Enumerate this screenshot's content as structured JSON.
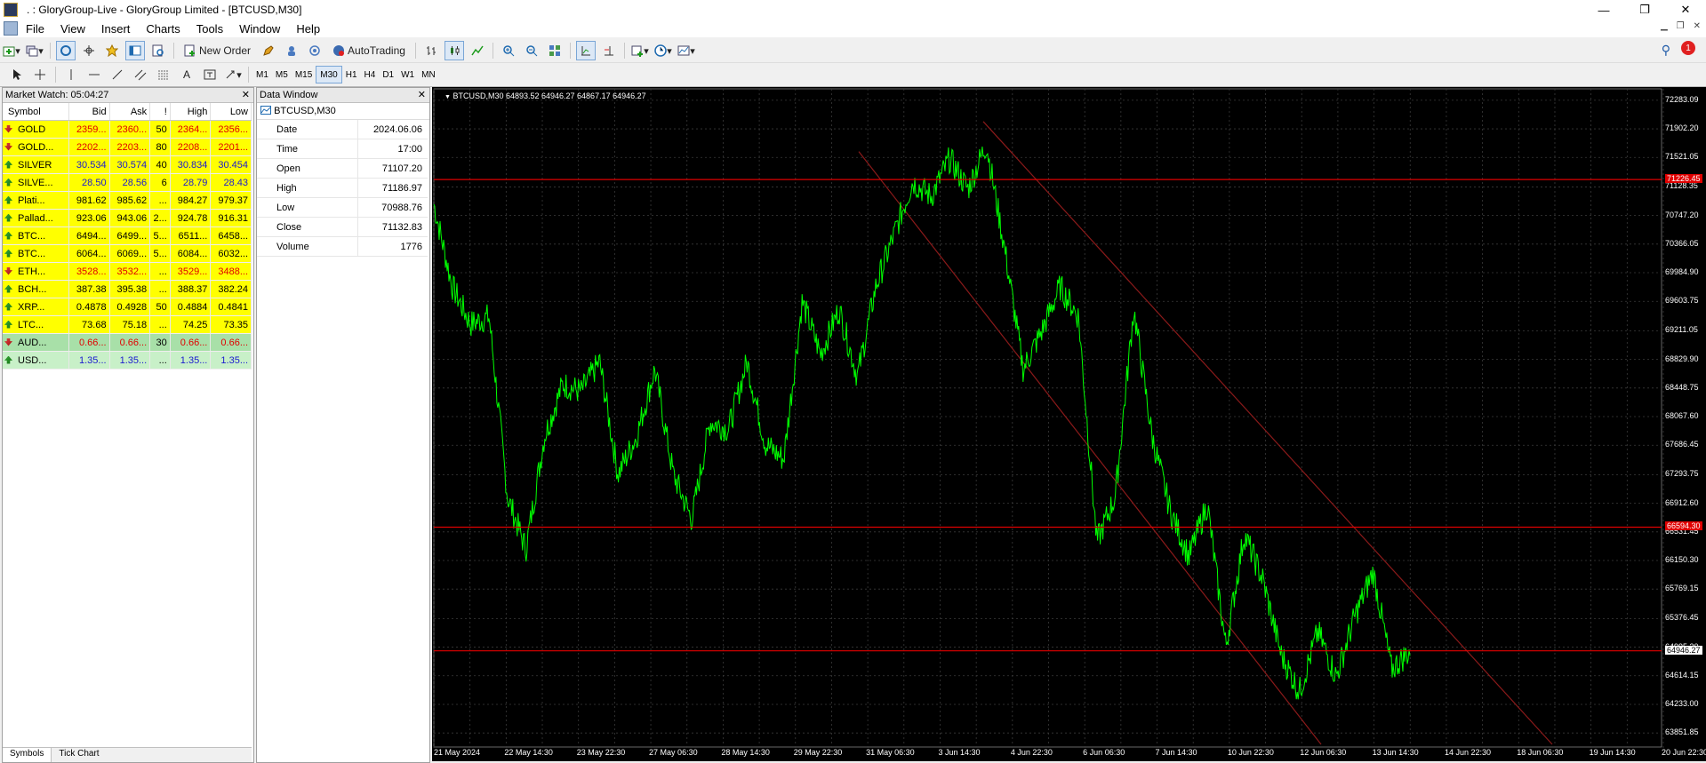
{
  "window": {
    "title": "   .   : GloryGroup-Live - GloryGroup Limited - [BTCUSD,M30]",
    "controls": [
      "—",
      "❐",
      "✕"
    ]
  },
  "menu": [
    "File",
    "View",
    "Insert",
    "Charts",
    "Tools",
    "Window",
    "Help"
  ],
  "toolbar": {
    "new_order": "New Order",
    "autotrading": "AutoTrading",
    "notification_count": "1"
  },
  "timeframes": [
    "M1",
    "M5",
    "M15",
    "M30",
    "H1",
    "H4",
    "D1",
    "W1",
    "MN"
  ],
  "active_timeframe": "M30",
  "market_watch": {
    "title": "Market Watch: 05:04:27",
    "columns": [
      "Symbol",
      "Bid",
      "Ask",
      "!",
      "High",
      "Low"
    ],
    "rows": [
      {
        "symbol": "GOLD",
        "bid": "2359...",
        "ask": "2360...",
        "spread": "50",
        "high": "2364...",
        "low": "2356...",
        "dir": "down",
        "bg": "#ffff00",
        "color": "#e00000"
      },
      {
        "symbol": "GOLD...",
        "bid": "2202...",
        "ask": "2203...",
        "spread": "80",
        "high": "2208...",
        "low": "2201...",
        "dir": "down",
        "bg": "#ffff00",
        "color": "#e00000"
      },
      {
        "symbol": "SILVER",
        "bid": "30.534",
        "ask": "30.574",
        "spread": "40",
        "high": "30.834",
        "low": "30.454",
        "dir": "up",
        "bg": "#ffff00",
        "color": "#1a1ad0"
      },
      {
        "symbol": "SILVE...",
        "bid": "28.50",
        "ask": "28.56",
        "spread": "6",
        "high": "28.79",
        "low": "28.43",
        "dir": "up",
        "bg": "#ffff00",
        "color": "#1a1ad0"
      },
      {
        "symbol": "Plati...",
        "bid": "981.62",
        "ask": "985.62",
        "spread": "...",
        "high": "984.27",
        "low": "979.37",
        "dir": "up",
        "bg": "#ffff00",
        "color": "#000000"
      },
      {
        "symbol": "Pallad...",
        "bid": "923.06",
        "ask": "943.06",
        "spread": "2...",
        "high": "924.78",
        "low": "916.31",
        "dir": "up",
        "bg": "#ffff00",
        "color": "#000000"
      },
      {
        "symbol": "BTC...",
        "bid": "6494...",
        "ask": "6499...",
        "spread": "5...",
        "high": "6511...",
        "low": "6458...",
        "dir": "up",
        "bg": "#ffff00",
        "color": "#000000"
      },
      {
        "symbol": "BTC...",
        "bid": "6064...",
        "ask": "6069...",
        "spread": "5...",
        "high": "6084...",
        "low": "6032...",
        "dir": "up",
        "bg": "#ffff00",
        "color": "#000000"
      },
      {
        "symbol": "ETH...",
        "bid": "3528...",
        "ask": "3532...",
        "spread": "...",
        "high": "3529...",
        "low": "3488...",
        "dir": "down",
        "bg": "#ffff00",
        "color": "#e00000"
      },
      {
        "symbol": "BCH...",
        "bid": "387.38",
        "ask": "395.38",
        "spread": "...",
        "high": "388.37",
        "low": "382.24",
        "dir": "up",
        "bg": "#ffff00",
        "color": "#000000"
      },
      {
        "symbol": "XRP...",
        "bid": "0.4878",
        "ask": "0.4928",
        "spread": "50",
        "high": "0.4884",
        "low": "0.4841",
        "dir": "up",
        "bg": "#ffff00",
        "color": "#000000"
      },
      {
        "symbol": "LTC...",
        "bid": "73.68",
        "ask": "75.18",
        "spread": "...",
        "high": "74.25",
        "low": "73.35",
        "dir": "up",
        "bg": "#ffff00",
        "color": "#000000"
      },
      {
        "symbol": "AUD...",
        "bid": "0.66...",
        "ask": "0.66...",
        "spread": "30",
        "high": "0.66...",
        "low": "0.66...",
        "dir": "down",
        "bg": "#a8e0a8",
        "color": "#e00000"
      },
      {
        "symbol": "USD...",
        "bid": "1.35...",
        "ask": "1.35...",
        "spread": "...",
        "high": "1.35...",
        "low": "1.35...",
        "dir": "up",
        "bg": "#c8f0c8",
        "color": "#1a1ad0"
      }
    ],
    "tabs": [
      "Symbols",
      "Tick Chart"
    ]
  },
  "data_window": {
    "title": "Data Window",
    "symbol": "BTCUSD,M30",
    "rows": [
      {
        "k": "Date",
        "v": "2024.06.06"
      },
      {
        "k": "Time",
        "v": "17:00"
      },
      {
        "k": "Open",
        "v": "71107.20"
      },
      {
        "k": "High",
        "v": "71186.97"
      },
      {
        "k": "Low",
        "v": "70988.76"
      },
      {
        "k": "Close",
        "v": "71132.83"
      },
      {
        "k": "Volume",
        "v": "1776"
      }
    ]
  },
  "chart": {
    "info": "BTCUSD,M30  64893.52 64946.27 64867.17 64946.27",
    "colors": {
      "background": "#000000",
      "line": "#00ff00",
      "grid": "#3a3a3a",
      "level": "#e00000",
      "channel": "#8b1a1a"
    },
    "price_labels": [
      "72283.09",
      "71902.20",
      "71521.05",
      "71128.35",
      "70747.20",
      "70366.05",
      "69984.90",
      "69603.75",
      "69211.05",
      "68829.90",
      "68448.75",
      "68067.60",
      "67686.45",
      "67293.75",
      "66912.60",
      "66531.45",
      "66150.30",
      "65769.15",
      "65376.45",
      "64995.30",
      "64614.15",
      "64233.00",
      "63851.85"
    ],
    "levels": [
      {
        "price": "71226.45",
        "style": "red"
      },
      {
        "price": "66594.30",
        "style": "red"
      },
      {
        "price": "64946.27",
        "style": "white"
      }
    ],
    "time_labels": [
      "21 May 2024",
      "22 May 14:30",
      "23 May 22:30",
      "27 May 06:30",
      "28 May 14:30",
      "29 May 22:30",
      "31 May 06:30",
      "3 Jun 14:30",
      "4 Jun 22:30",
      "6 Jun 06:30",
      "7 Jun 14:30",
      "10 Jun 22:30",
      "12 Jun 06:30",
      "13 Jun 14:30",
      "14 Jun 22:30",
      "18 Jun 06:30",
      "19 Jun 14:30",
      "20 Jun 22:30"
    ]
  },
  "chart_data": {
    "type": "line",
    "ylim": [
      63700,
      72400
    ],
    "x": [
      "21 May 2024",
      "22 May 14:30",
      "23 May 22:30",
      "27 May 06:30",
      "28 May 14:30",
      "29 May 22:30",
      "31 May 06:30",
      "3 Jun 14:30",
      "4 Jun 22:30",
      "6 Jun 06:30",
      "7 Jun 14:30",
      "10 Jun 22:30",
      "12 Jun 06:30",
      "13 Jun 14:30",
      "14 Jun 22:30",
      "18 Jun 06:30",
      "19 Jun 14:30",
      "20 Jun 22:30"
    ],
    "series": [
      {
        "values": [
          70900,
          69800,
          69300,
          69400,
          67000,
          66300,
          67800,
          68500,
          68400,
          68800,
          67300,
          67800,
          68700,
          67300,
          66700,
          68000,
          67900,
          68800,
          67700,
          67500,
          69600,
          68900,
          69500,
          68600,
          69800,
          70500,
          71200,
          71000,
          71500,
          71100,
          71700,
          70300,
          68700,
          69200,
          69800,
          69400,
          66400,
          67000,
          69500,
          67800,
          66800,
          66200,
          66900,
          65000,
          66500,
          65900,
          64900,
          64400,
          65200,
          64600,
          65400,
          66000,
          64700,
          64946
        ]
      }
    ],
    "levels": [
      71226.45,
      66594.3,
      64946.27
    ],
    "grid": true
  }
}
